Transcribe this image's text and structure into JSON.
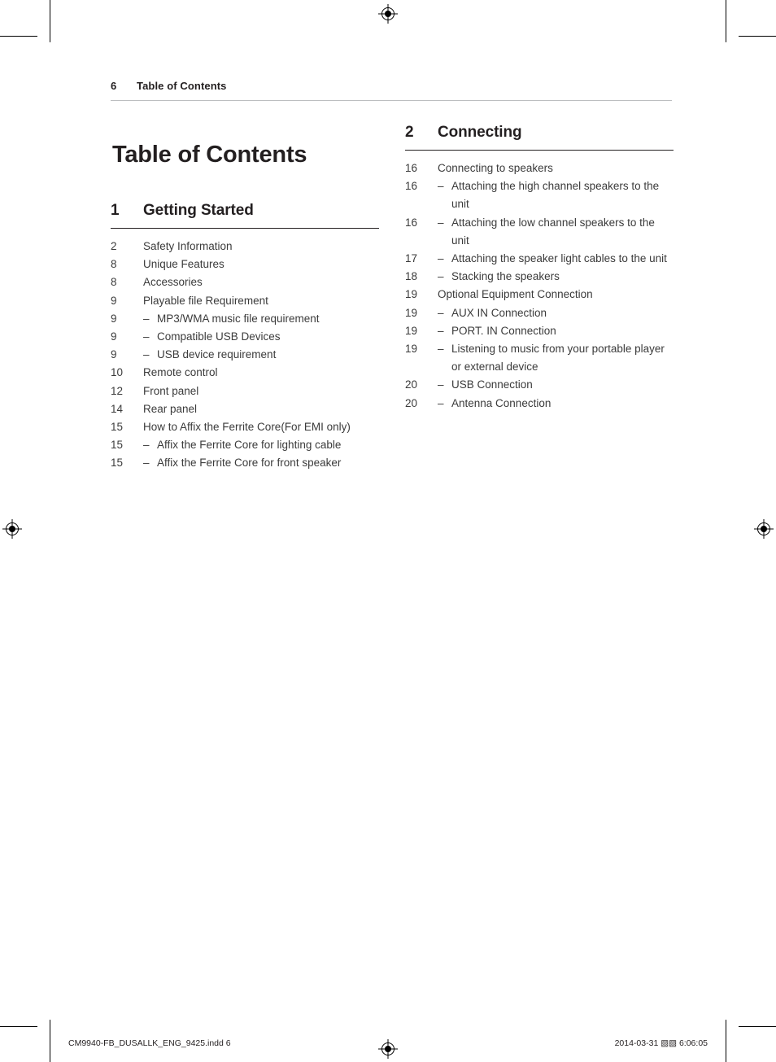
{
  "header": {
    "page_number": "6",
    "title": "Table of Contents"
  },
  "main_title": "Table of Contents",
  "sections": [
    {
      "number": "1",
      "name": "Getting Started",
      "entries": [
        {
          "page": "2",
          "text": "Safety Information",
          "sub": false
        },
        {
          "page": "8",
          "text": "Unique Features",
          "sub": false
        },
        {
          "page": "8",
          "text": "Accessories",
          "sub": false
        },
        {
          "page": "9",
          "text": "Playable file Requirement",
          "sub": false
        },
        {
          "page": "9",
          "text": "MP3/WMA music file requirement",
          "sub": true
        },
        {
          "page": "9",
          "text": "Compatible USB Devices",
          "sub": true
        },
        {
          "page": "9",
          "text": "USB device requirement",
          "sub": true
        },
        {
          "page": "10",
          "text": "Remote control",
          "sub": false
        },
        {
          "page": "12",
          "text": "Front panel",
          "sub": false
        },
        {
          "page": "14",
          "text": "Rear panel",
          "sub": false
        },
        {
          "page": "15",
          "text": "How to Affix the Ferrite Core(For EMI only)",
          "sub": false
        },
        {
          "page": "15",
          "text": "Affix the Ferrite Core for lighting cable",
          "sub": true
        },
        {
          "page": "15",
          "text": "Affix the Ferrite Core for front speaker",
          "sub": true
        }
      ]
    },
    {
      "number": "2",
      "name": "Connecting",
      "entries": [
        {
          "page": "16",
          "text": "Connecting to speakers",
          "sub": false
        },
        {
          "page": "16",
          "text": "Attaching the high channel speakers to the unit",
          "sub": true
        },
        {
          "page": "16",
          "text": "Attaching the low channel speakers to the unit",
          "sub": true
        },
        {
          "page": "17",
          "text": "Attaching the speaker light cables to the unit",
          "sub": true
        },
        {
          "page": "18",
          "text": "Stacking the speakers",
          "sub": true
        },
        {
          "page": "19",
          "text": "Optional Equipment Connection",
          "sub": false
        },
        {
          "page": "19",
          "text": "AUX IN Connection",
          "sub": true
        },
        {
          "page": "19",
          "text": "PORT. IN Connection",
          "sub": true
        },
        {
          "page": "19",
          "text": "Listening to music from your portable player or external device",
          "sub": true
        },
        {
          "page": "20",
          "text": "USB Connection",
          "sub": true
        },
        {
          "page": "20",
          "text": "Antenna Connection",
          "sub": true
        }
      ]
    }
  ],
  "footer": {
    "left": "CM9940-FB_DUSALLK_ENG_9425.indd   6",
    "right": "2014-03-31   ▧▧ 6:06:05"
  }
}
